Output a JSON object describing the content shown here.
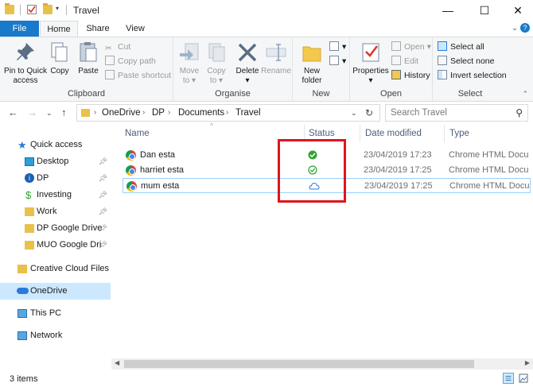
{
  "window": {
    "title": "Travel",
    "minimize": "—",
    "maximize": "☐",
    "close": "✕"
  },
  "ribbon_tabs": {
    "file": "File",
    "home": "Home",
    "share": "Share",
    "view": "View"
  },
  "ribbon": {
    "clipboard": {
      "group_label": "Clipboard",
      "pin": "Pin to Quick access",
      "copy": "Copy",
      "paste": "Paste",
      "cut": "Cut",
      "copy_path": "Copy path",
      "paste_shortcut": "Paste shortcut"
    },
    "organise": {
      "group_label": "Organise",
      "move_to": "Move to",
      "copy_to": "Copy to",
      "delete": "Delete",
      "rename": "Rename"
    },
    "new": {
      "group_label": "New",
      "new_folder": "New folder"
    },
    "open": {
      "group_label": "Open",
      "properties": "Properties",
      "open": "Open",
      "edit": "Edit",
      "history": "History"
    },
    "select": {
      "group_label": "Select",
      "select_all": "Select all",
      "select_none": "Select none",
      "invert": "Invert selection"
    }
  },
  "address": {
    "crumbs": [
      "OneDrive",
      "DP",
      "Documents",
      "Travel"
    ]
  },
  "search": {
    "placeholder": "Search Travel"
  },
  "nav": {
    "quick_access": "Quick access",
    "items": [
      {
        "label": "Desktop",
        "pinned": true
      },
      {
        "label": "DP",
        "pinned": true
      },
      {
        "label": "Investing",
        "pinned": true
      },
      {
        "label": "Work",
        "pinned": true
      },
      {
        "label": "DP Google Drive",
        "pinned": true
      },
      {
        "label": "MUO Google Dri",
        "pinned": true
      }
    ],
    "creative_cloud": "Creative Cloud Files",
    "onedrive": "OneDrive",
    "this_pc": "This PC",
    "network": "Network"
  },
  "columns": {
    "name": "Name",
    "status": "Status",
    "date": "Date modified",
    "type": "Type"
  },
  "files": [
    {
      "name": "Dan esta",
      "status": "always-available",
      "date": "23/04/2019 17:23",
      "type": "Chrome HTML Docu"
    },
    {
      "name": "harriet esta",
      "status": "locally-available",
      "date": "23/04/2019 17:25",
      "type": "Chrome HTML Docu"
    },
    {
      "name": "mum esta",
      "status": "online-only",
      "date": "23/04/2019 17:25",
      "type": "Chrome HTML Docu"
    }
  ],
  "statusbar": {
    "count": "3 items"
  },
  "colors": {
    "accent": "#1979ca",
    "highlight": "#e0141e",
    "selected": "#cce8ff",
    "green": "#2fa52f",
    "cloud": "#2a7ad8"
  }
}
